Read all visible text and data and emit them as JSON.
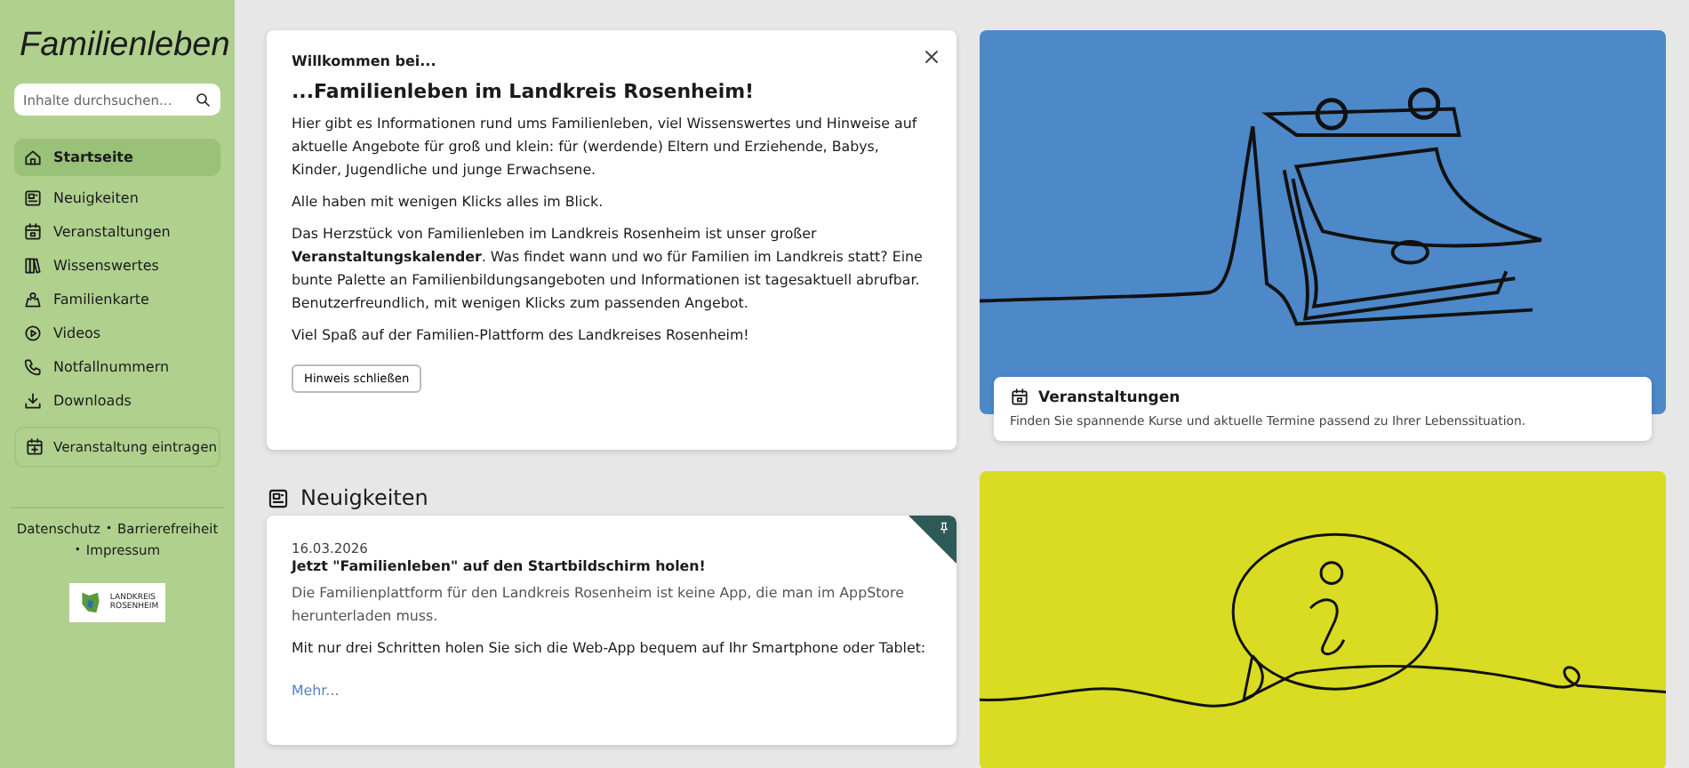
{
  "sidebar": {
    "title": "Familienleben",
    "search": {
      "placeholder": "Inhalte durchsuchen..."
    },
    "items": [
      {
        "label": "Startseite",
        "selected": true
      },
      {
        "label": "Neuigkeiten",
        "selected": false
      },
      {
        "label": "Veranstaltungen",
        "selected": false
      },
      {
        "label": "Wissenswertes",
        "selected": false
      },
      {
        "label": "Familienkarte",
        "selected": false
      },
      {
        "label": "Videos",
        "selected": false
      },
      {
        "label": "Notfallnummern",
        "selected": false
      },
      {
        "label": "Downloads",
        "selected": false
      }
    ],
    "action": {
      "label": "Veranstaltung eintragen"
    },
    "footer": [
      {
        "kind": "link",
        "text": "Datenschutz"
      },
      {
        "kind": "separator",
        "text": "•"
      },
      {
        "kind": "link",
        "text": "Barrierefreiheit"
      },
      {
        "kind": "separator",
        "text": "•"
      },
      {
        "kind": "link",
        "text": "Impressum"
      }
    ],
    "logo": {
      "lines": [
        "LANDKREIS",
        "ROSENHEIM"
      ]
    }
  },
  "welcome": {
    "kicker": "Willkommen bei...",
    "title": "...Familienleben im Landkreis Rosenheim!",
    "paragraphs": [
      "Hier gibt es Informationen rund ums Familienleben, viel Wissenswertes und Hinweise auf aktuelle Angebote für groß und klein: für (werdende) Eltern und Erziehende, Babys, Kinder, Jugendliche und junge Erwachsene.",
      "Alle haben mit wenigen Klicks alles im Blick.",
      "Das Herzstück von Familienleben im Landkreis Rosenheim ist unser großer **Veranstaltungskalender**. Was findet wann und wo für Familien im Landkreis statt? Eine bunte Palette an Familienbildungsangeboten und Informationen ist tagesaktuell abrufbar. Benutzerfreundlich, mit wenigen Klicks zum passenden Angebot.",
      "Viel Spaß auf der Familien-Plattform des Landkreises Rosenheim!"
    ],
    "button": "Hinweis schließen"
  },
  "news": {
    "heading": "Neuigkeiten",
    "items": [
      {
        "date": "16.03.2026",
        "title": "Jetzt \"Familienleben\" auf den Startbildschirm holen!",
        "pinned": true,
        "paragraphs": [
          "Die Familienplattform für den Landkreis Rosenheim ist keine App, die man im AppStore herunterladen muss.",
          "Mit nur drei Schritten holen Sie sich die Web-App bequem auf Ihr Smartphone oder Tablet:"
        ],
        "more": "Mehr..."
      }
    ]
  },
  "tiles": [
    {
      "kind": "calendar",
      "title": "Veranstaltungen",
      "text": "Finden Sie spannende Kurse und aktuelle Termine passend zu Ihrer Lebenssituation."
    },
    {
      "kind": "info"
    }
  ]
}
